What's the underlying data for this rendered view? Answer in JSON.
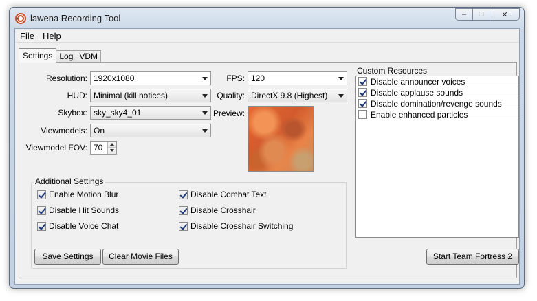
{
  "window": {
    "title": "lawena Recording Tool"
  },
  "menu": [
    "File",
    "Help"
  ],
  "tabs": [
    "Settings",
    "Log",
    "VDM"
  ],
  "settings": {
    "resolution": {
      "label": "Resolution:",
      "value": "1920x1080"
    },
    "hud": {
      "label": "HUD:",
      "value": "Minimal (kill notices)"
    },
    "skybox": {
      "label": "Skybox:",
      "value": "sky_sky4_01"
    },
    "viewmodels": {
      "label": "Viewmodels:",
      "value": "On"
    },
    "viewmodel_fov": {
      "label": "Viewmodel FOV:",
      "value": "70"
    },
    "fps": {
      "label": "FPS:",
      "value": "120"
    },
    "quality": {
      "label": "Quality:",
      "value": "DirectX 9.8 (Highest)"
    },
    "preview": {
      "label": "Preview:"
    }
  },
  "additional": {
    "title": "Additional Settings",
    "items": [
      {
        "label": "Enable Motion Blur",
        "checked": true
      },
      {
        "label": "Disable Hit Sounds",
        "checked": true
      },
      {
        "label": "Disable Voice Chat",
        "checked": true
      },
      {
        "label": "Disable Combat Text",
        "checked": true
      },
      {
        "label": "Disable Crosshair",
        "checked": true
      },
      {
        "label": "Disable Crosshair Switching",
        "checked": true
      }
    ]
  },
  "custom_resources": {
    "title": "Custom Resources",
    "items": [
      {
        "label": "Disable announcer voices",
        "checked": true
      },
      {
        "label": "Disable applause sounds",
        "checked": true
      },
      {
        "label": "Disable domination/revenge sounds",
        "checked": true
      },
      {
        "label": "Enable enhanced particles",
        "checked": false
      }
    ]
  },
  "buttons": {
    "save": "Save Settings",
    "clear": "Clear Movie Files",
    "start": "Start Team Fortress 2"
  }
}
